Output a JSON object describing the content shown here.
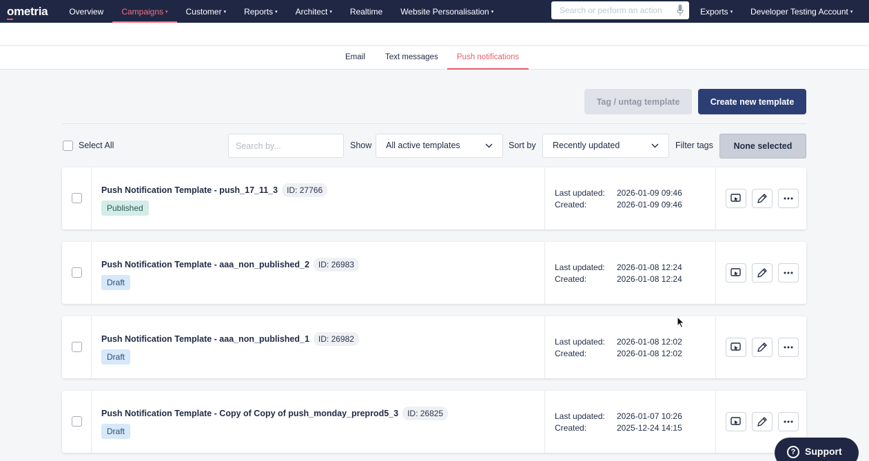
{
  "nav": {
    "logo": "ometria",
    "items": [
      {
        "label": "Overview",
        "caret": false,
        "active": false
      },
      {
        "label": "Campaigns",
        "caret": true,
        "active": true
      },
      {
        "label": "Customer",
        "caret": true,
        "active": false
      },
      {
        "label": "Reports",
        "caret": true,
        "active": false
      },
      {
        "label": "Architect",
        "caret": true,
        "active": false
      },
      {
        "label": "Realtime",
        "caret": false,
        "active": false
      },
      {
        "label": "Website Personalisation",
        "caret": true,
        "active": false
      }
    ],
    "search_placeholder": "Search or perform an action",
    "exports_label": "Exports",
    "account_label": "Developer Testing Account",
    "caret_glyph": "▾"
  },
  "subtabs": [
    {
      "label": "Email",
      "active": false
    },
    {
      "label": "Text messages",
      "active": false
    },
    {
      "label": "Push notifications",
      "active": true
    }
  ],
  "toolbar": {
    "tag_label": "Tag / untag template",
    "create_label": "Create new template"
  },
  "filters": {
    "select_all_label": "Select All",
    "search_placeholder": "Search by...",
    "show_label": "Show",
    "show_value": "All active templates",
    "sort_label": "Sort by",
    "sort_value": "Recently updated",
    "filter_tags_label": "Filter tags",
    "filter_tags_value": "None selected"
  },
  "meta_labels": {
    "updated": "Last updated:",
    "created": "Created:"
  },
  "templates": [
    {
      "name": "Push Notification Template - push_17_11_3",
      "id": "ID: 27766",
      "status": "Published",
      "status_type": "published",
      "updated": "2026-01-09 09:46",
      "created": "2026-01-09 09:46"
    },
    {
      "name": "Push Notification Template - aaa_non_published_2",
      "id": "ID: 26983",
      "status": "Draft",
      "status_type": "draft",
      "updated": "2026-01-08 12:24",
      "created": "2026-01-08 12:24"
    },
    {
      "name": "Push Notification Template - aaa_non_published_1",
      "id": "ID: 26982",
      "status": "Draft",
      "status_type": "draft",
      "updated": "2026-01-08 12:02",
      "created": "2026-01-08 12:02"
    },
    {
      "name": "Push Notification Template - Copy of Copy of push_monday_preprod5_3",
      "id": "ID: 26825",
      "status": "Draft",
      "status_type": "draft",
      "updated": "2026-01-07 10:26",
      "created": "2025-12-24 14:15"
    }
  ],
  "support_label": "Support",
  "support_glyph": "?",
  "colors": {
    "nav_bg": "#1f2745",
    "accent": "#ee5a6b",
    "primary_button": "#2b3f75",
    "published_badge": "#d3ece7",
    "draft_badge": "#d6e8f9"
  },
  "icons": [
    "microphone-icon",
    "chevron-down-icon",
    "preview-icon",
    "edit-pencil-icon",
    "more-dots-icon",
    "help-icon",
    "mouse-cursor-icon"
  ]
}
